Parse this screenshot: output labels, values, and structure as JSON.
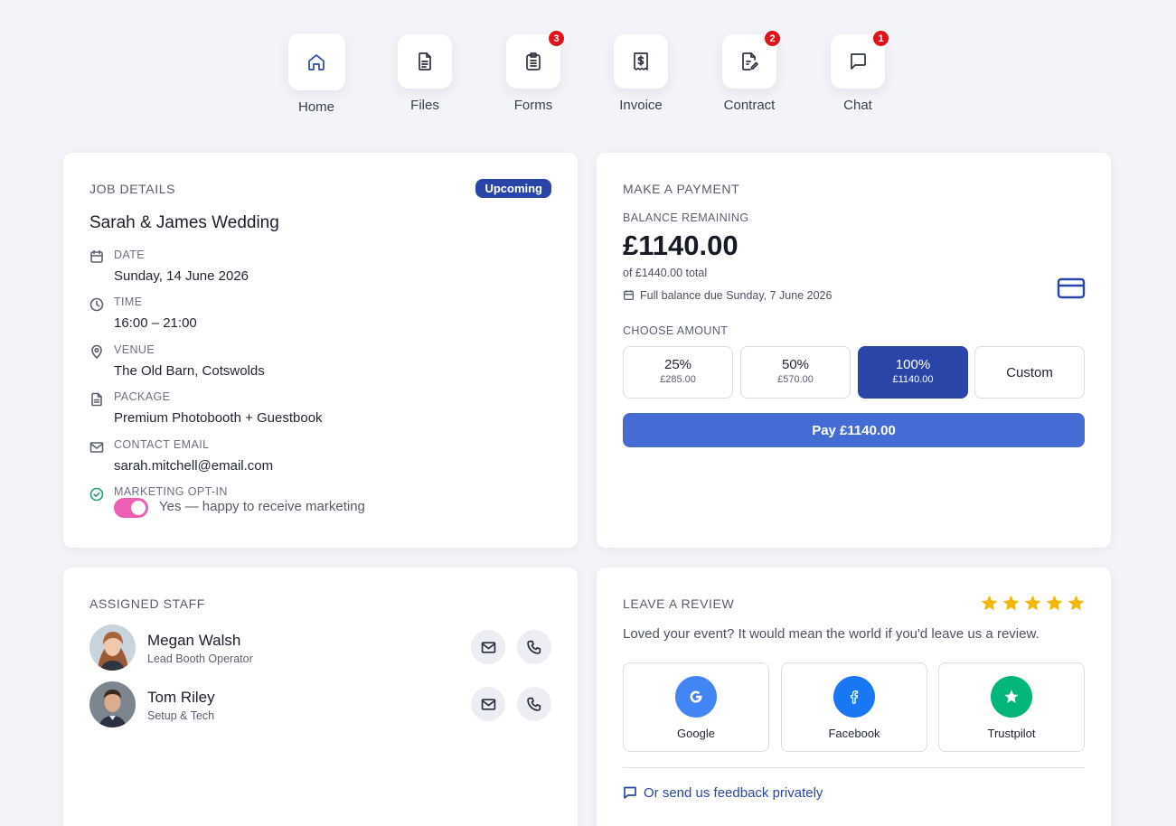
{
  "nav": {
    "items": [
      {
        "label": "Home",
        "icon": "home-icon"
      },
      {
        "label": "Files",
        "icon": "file-icon"
      },
      {
        "label": "Forms",
        "icon": "clipboard-icon",
        "badge": "3"
      },
      {
        "label": "Invoice",
        "icon": "receipt-icon"
      },
      {
        "label": "Contract",
        "icon": "contract-edit-icon",
        "badge": "2"
      },
      {
        "label": "Chat",
        "icon": "chat-icon",
        "badge": "1"
      }
    ]
  },
  "job": {
    "title": "JOB DETAILS",
    "status": "Upcoming",
    "name": "Sarah & James Wedding",
    "date_label": "DATE",
    "date": "Sunday, 14 June 2026",
    "time_label": "TIME",
    "time": "16:00 – 21:00",
    "venue_label": "VENUE",
    "venue": "The Old Barn, Cotswolds",
    "package_label": "PACKAGE",
    "package": "Premium Photobooth + Guestbook",
    "email_label": "CONTACT EMAIL",
    "email": "sarah.mitchell@email.com",
    "marketing_label": "MARKETING OPT-IN",
    "marketing_text": "Yes — happy to receive marketing",
    "marketing_on": true
  },
  "payment": {
    "title": "MAKE A PAYMENT",
    "balance_label": "BALANCE REMAINING",
    "balance": "£1140.00",
    "total": "of £1440.00 total",
    "due": "Full balance due Sunday, 7 June 2026",
    "choose_label": "CHOOSE AMOUNT",
    "options": [
      {
        "pct": "25%",
        "amount": "£285.00"
      },
      {
        "pct": "50%",
        "amount": "£570.00"
      },
      {
        "pct": "100%",
        "amount": "£1140.00",
        "selected": true
      },
      {
        "pct": "Custom"
      }
    ],
    "pay_label": "Pay £1140.00"
  },
  "staff": {
    "title": "ASSIGNED STAFF",
    "members": [
      {
        "name": "Megan Walsh",
        "role": "Lead Booth Operator"
      },
      {
        "name": "Tom Riley",
        "role": "Setup & Tech"
      }
    ]
  },
  "review": {
    "title": "LEAVE A REVIEW",
    "rating": 5,
    "text": "Loved your event? It would mean the world if you'd leave us a review.",
    "platforms": [
      {
        "name": "Google",
        "color": "#4285f4"
      },
      {
        "name": "Facebook",
        "color": "#1877f2"
      },
      {
        "name": "Trustpilot",
        "color": "#00b67a"
      }
    ],
    "feedback": "Or send us feedback privately"
  },
  "colors": {
    "accent": "#2a45a8",
    "pay_button": "#456cd4",
    "toggle": "#ec5fb4",
    "badge": "#e0121a",
    "stars": "#f6b500"
  }
}
